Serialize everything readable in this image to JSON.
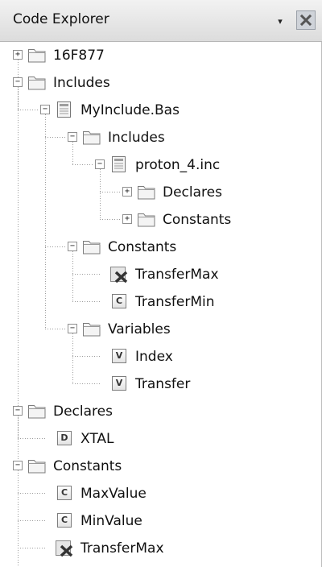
{
  "panel": {
    "title": "Code Explorer",
    "pin_glyph": "▾",
    "close_icon": "close-icon"
  },
  "tree": [
    {
      "label": "16F877",
      "icon": "folder-icon",
      "expander": "+",
      "depth": 0
    },
    {
      "label": "Includes",
      "icon": "folder-icon",
      "expander": "−",
      "depth": 0
    },
    {
      "label": "MyInclude.Bas",
      "icon": "file-include-icon",
      "expander": "−",
      "depth": 1
    },
    {
      "label": "Includes",
      "icon": "folder-icon",
      "expander": "−",
      "depth": 2
    },
    {
      "label": "proton_4.inc",
      "icon": "file-include-icon",
      "expander": "−",
      "depth": 3
    },
    {
      "label": "Declares",
      "icon": "folder-icon",
      "expander": "+",
      "depth": 4
    },
    {
      "label": "Constants",
      "icon": "folder-icon",
      "expander": "+",
      "depth": 4
    },
    {
      "label": "Constants",
      "icon": "folder-icon",
      "expander": "−",
      "depth": 2
    },
    {
      "label": "TransferMax",
      "icon": "error-icon",
      "depth": 3
    },
    {
      "label": "TransferMin",
      "icon": "constant-icon",
      "badge": "C",
      "depth": 3
    },
    {
      "label": "Variables",
      "icon": "folder-icon",
      "expander": "−",
      "depth": 2
    },
    {
      "label": "Index",
      "icon": "variable-icon",
      "badge": "V",
      "depth": 3
    },
    {
      "label": "Transfer",
      "icon": "variable-icon",
      "badge": "V",
      "depth": 3
    },
    {
      "label": "Declares",
      "icon": "folder-icon",
      "expander": "−",
      "depth": 0
    },
    {
      "label": "XTAL",
      "icon": "declare-icon",
      "badge": "D",
      "depth": 1
    },
    {
      "label": "Constants",
      "icon": "folder-icon",
      "expander": "−",
      "depth": 0
    },
    {
      "label": "MaxValue",
      "icon": "constant-icon",
      "badge": "C",
      "depth": 1
    },
    {
      "label": "MinValue",
      "icon": "constant-icon",
      "badge": "C",
      "depth": 1
    },
    {
      "label": "TransferMax",
      "icon": "error-icon",
      "depth": 1
    }
  ]
}
